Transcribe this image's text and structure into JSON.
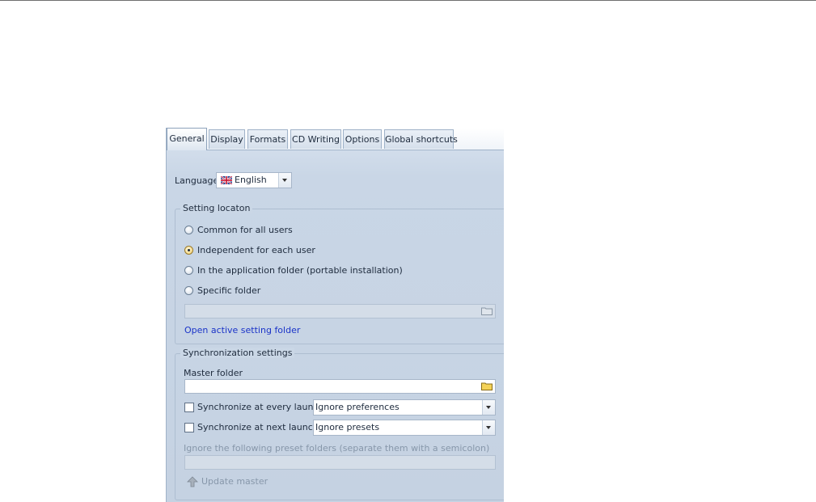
{
  "tabs": [
    {
      "label": "General",
      "active": true
    },
    {
      "label": "Display",
      "active": false
    },
    {
      "label": "Formats",
      "active": false
    },
    {
      "label": "CD Writing",
      "active": false
    },
    {
      "label": "Options",
      "active": false
    },
    {
      "label": "Global shortcuts",
      "active": false
    }
  ],
  "language": {
    "label": "Language",
    "value": "English",
    "flag_icon": "uk-flag-icon"
  },
  "setting_location": {
    "title": "Setting locaton",
    "options": [
      {
        "label": "Common for all users",
        "checked": false
      },
      {
        "label": "Independent for each user",
        "checked": true
      },
      {
        "label": "In the application folder (portable installation)",
        "checked": false
      },
      {
        "label": "Specific folder",
        "checked": false
      }
    ],
    "folder_value": "",
    "open_link": "Open active setting folder"
  },
  "sync": {
    "title": "Synchronization settings",
    "master_folder_label": "Master folder",
    "master_folder_value": "",
    "every_launch": {
      "label": "Synchronize at every launch",
      "checked": false,
      "option": "Ignore preferences"
    },
    "next_launch": {
      "label": "Synchronize at next launch",
      "checked": false,
      "option": "Ignore presets"
    },
    "ignore_label": "Ignore the following preset folders (separate them with a semicolon)",
    "ignore_value": "",
    "update_button": "Update master"
  },
  "colors": {
    "accent_link": "#1a33c8",
    "panel_bg": "#c9d6e6",
    "radio_checked": "#f3cf6d"
  }
}
